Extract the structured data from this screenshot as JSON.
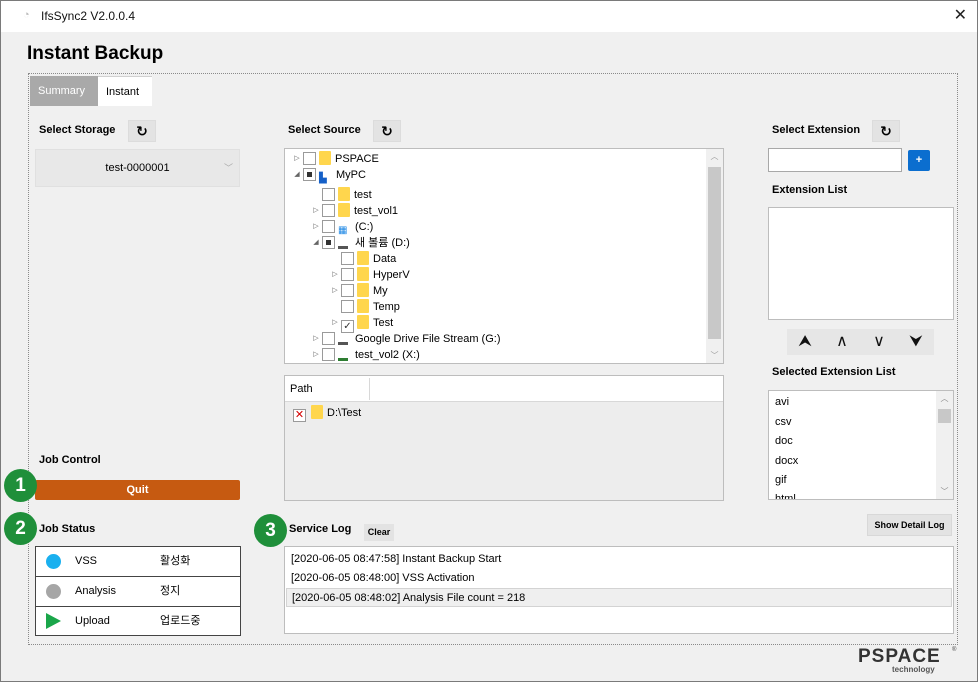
{
  "window": {
    "title": "IfsSync2 V2.0.0.4",
    "close_glyph": "✕"
  },
  "page_title": "Instant Backup",
  "tabs": [
    {
      "label": "Summary"
    },
    {
      "label": "Instant"
    }
  ],
  "storage": {
    "label": "Select Storage",
    "selected": "test-0000001"
  },
  "source": {
    "label": "Select Source",
    "tree": [
      {
        "label": "PSPACE",
        "expander": "▷",
        "check": "",
        "icon": "folder-icon"
      },
      {
        "label": "MyPC",
        "expander": "◢",
        "check": "partial",
        "icon": "computer-icon"
      },
      {
        "label": "test",
        "expander": "",
        "check": "",
        "icon": "network-folder-icon"
      },
      {
        "label": "test_vol1",
        "expander": "▷",
        "check": "",
        "icon": "network-folder-icon"
      },
      {
        "label": "(C:)",
        "expander": "▷",
        "check": "",
        "icon": "windows-drive-icon"
      },
      {
        "label": "새 볼륨 (D:)",
        "expander": "◢",
        "check": "partial",
        "icon": "drive-icon"
      },
      {
        "label": "Data",
        "expander": "",
        "check": "",
        "icon": "folder-icon"
      },
      {
        "label": "HyperV",
        "expander": "▷",
        "check": "",
        "icon": "folder-icon"
      },
      {
        "label": "My",
        "expander": "▷",
        "check": "",
        "icon": "folder-icon"
      },
      {
        "label": "Temp",
        "expander": "",
        "check": "",
        "icon": "folder-icon"
      },
      {
        "label": "Test",
        "expander": "▷",
        "check": "✓",
        "icon": "folder-icon"
      },
      {
        "label": "Google Drive File Stream (G:)",
        "expander": "▷",
        "check": "",
        "icon": "drive-icon"
      },
      {
        "label": "test_vol2 (X:)",
        "expander": "▷",
        "check": "",
        "icon": "network-drive-icon"
      }
    ],
    "path_header": "Path",
    "paths": [
      {
        "value": "D:\\Test",
        "remove_glyph": "✕"
      }
    ]
  },
  "extension": {
    "label": "Select Extension",
    "input_value": "",
    "add_glyph": "+",
    "list_label": "Extension List",
    "list": [],
    "move_glyphs": {
      "top": "⮝",
      "up": "∧",
      "down": "∨",
      "bottom": "⮟"
    },
    "selected_label": "Selected Extension List",
    "selected": [
      "avi",
      "csv",
      "doc",
      "docx",
      "gif",
      "html"
    ]
  },
  "job_control": {
    "label": "Job Control",
    "quit_label": "Quit"
  },
  "job_status": {
    "label": "Job Status",
    "rows": [
      {
        "name": "VSS",
        "value": "활성화",
        "icon": "blue-dot-icon",
        "color": "#1ab0ef"
      },
      {
        "name": "Analysis",
        "value": "정지",
        "icon": "gray-dot-icon",
        "color": "#a6a6a6"
      },
      {
        "name": "Upload",
        "value": "업로드중",
        "icon": "green-play-icon",
        "color": "#1aa64a"
      }
    ]
  },
  "service_log": {
    "label": "Service Log",
    "clear_label": "Clear",
    "detail_label": "Show Detail Log",
    "entries": [
      "[2020-06-05 08:47:58] Instant Backup Start",
      "[2020-06-05 08:48:00] VSS Activation",
      "[2020-06-05 08:48:02] Analysis File count = 218"
    ]
  },
  "markers": [
    "1",
    "2",
    "3"
  ],
  "brand": {
    "name": "PSPACE",
    "reg": "®",
    "sub": "technology"
  },
  "colors": {
    "quit": "#c65a11",
    "accent": "#0b6ecf",
    "marker": "#1f8f3a"
  }
}
